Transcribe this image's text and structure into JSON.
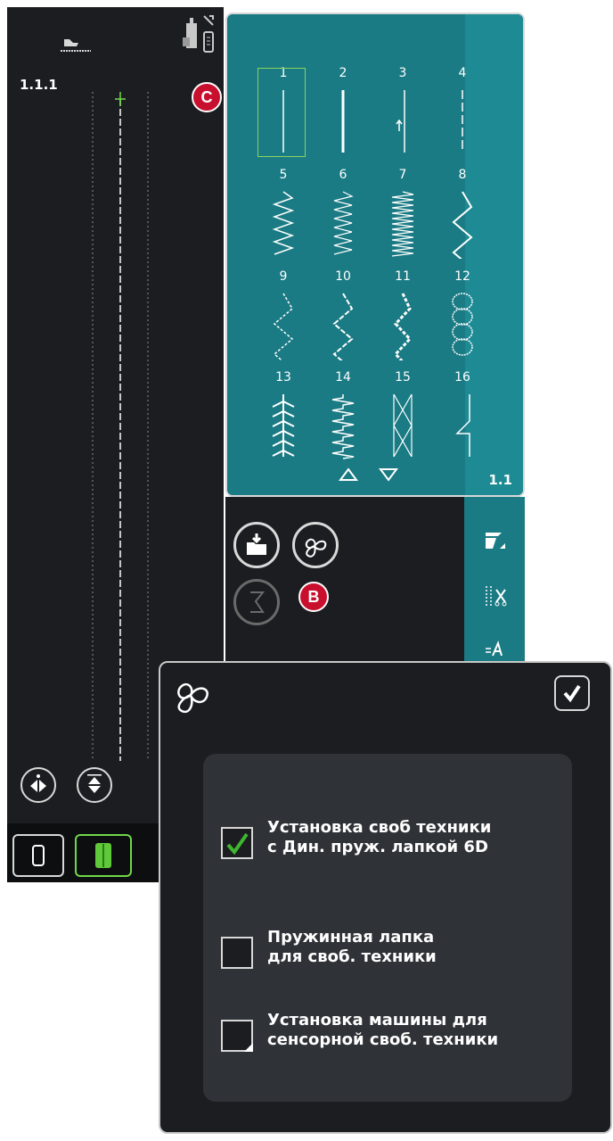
{
  "preview": {
    "stitch_code": "1.1.1"
  },
  "callouts": {
    "c": "C",
    "b": "B"
  },
  "stitch_menu": {
    "page_label": "1.1",
    "selected_stitch": "1",
    "stitches": [
      {
        "num": "1",
        "icon": "straight-stitch-icon"
      },
      {
        "num": "2",
        "icon": "triple-straight-stitch-icon"
      },
      {
        "num": "3",
        "icon": "straight-stitch-reverse-icon"
      },
      {
        "num": "4",
        "icon": "basting-stitch-icon"
      },
      {
        "num": "5",
        "icon": "zigzag-stitch-icon"
      },
      {
        "num": "6",
        "icon": "three-step-zigzag-icon"
      },
      {
        "num": "7",
        "icon": "dense-zigzag-icon"
      },
      {
        "num": "8",
        "icon": "wide-zigzag-icon"
      },
      {
        "num": "9",
        "icon": "multi-step-zigzag-icon"
      },
      {
        "num": "10",
        "icon": "triple-zigzag-icon"
      },
      {
        "num": "11",
        "icon": "stretch-zigzag-icon"
      },
      {
        "num": "12",
        "icon": "honeycomb-stitch-icon"
      },
      {
        "num": "13",
        "icon": "feather-stitch-icon"
      },
      {
        "num": "14",
        "icon": "overlock-stitch-icon"
      },
      {
        "num": "15",
        "icon": "cross-stitch-icon"
      },
      {
        "num": "16",
        "icon": "blind-hem-stitch-icon"
      }
    ]
  },
  "dialog": {
    "options": [
      {
        "label": "Установка своб техники\nс Дин. пруж. лапкой 6D",
        "checked": true
      },
      {
        "label": "Пружинная лапка\nдля своб. техники",
        "checked": false
      },
      {
        "label": "Установка машины для\nсенсорной своб. техники",
        "checked": false
      }
    ]
  },
  "colors": {
    "accent_teal": "#1a7b84",
    "panel_dark": "#1b1d20",
    "callout_red": "#c8102e",
    "selection_green": "#8bd35b",
    "checkmark_green": "#3fb62f"
  }
}
